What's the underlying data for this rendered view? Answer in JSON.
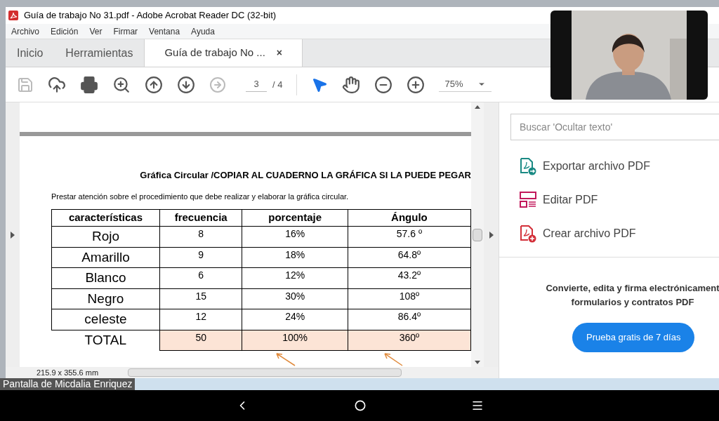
{
  "window": {
    "title": "Guía de trabajo No 31.pdf - Adobe Acrobat Reader DC (32-bit)"
  },
  "menu": [
    "Archivo",
    "Edición",
    "Ver",
    "Firmar",
    "Ventana",
    "Ayuda"
  ],
  "tabs": [
    {
      "label": "Inicio",
      "selected": false
    },
    {
      "label": "Herramientas",
      "selected": false
    },
    {
      "label": "Guía de trabajo No ...",
      "selected": true,
      "close": "×"
    }
  ],
  "toolbar": {
    "page": "3",
    "pages": "/ 4",
    "zoom": "75%"
  },
  "document": {
    "heading": "Gráfica Circular /COPIAR AL CUADERNO LA GRÁFICA SI LA PUEDE PEGAR",
    "instruction": "Prestar atención sobre el procedimiento que debe realizar y elaborar la gráfica circular.",
    "table": {
      "columns": [
        "características",
        "frecuencia",
        "porcentaje",
        "Ángulo"
      ],
      "rows": [
        {
          "kind": "data",
          "cells": [
            "Rojo",
            "8",
            "16%",
            "57.6 º"
          ]
        },
        {
          "kind": "data",
          "cells": [
            "Amarillo",
            "9",
            "18%",
            "64.8º"
          ]
        },
        {
          "kind": "data",
          "cells": [
            "Blanco",
            "6",
            "12%",
            "43.2º"
          ]
        },
        {
          "kind": "data",
          "cells": [
            "Negro",
            "15",
            "30%",
            "108º"
          ]
        },
        {
          "kind": "data",
          "cells": [
            "celeste",
            "12",
            "24%",
            "86.4º"
          ]
        },
        {
          "kind": "total",
          "cells": [
            "TOTAL",
            "50",
            "100%",
            "360º"
          ]
        }
      ]
    }
  },
  "page_size": "215.9 x 355.6 mm",
  "tools_pane": {
    "search": {
      "placeholder": "Buscar 'Ocultar texto'"
    },
    "tools": [
      {
        "kind": "export",
        "label": "Exportar archivo PDF"
      },
      {
        "kind": "edit",
        "label": "Editar PDF"
      },
      {
        "kind": "create",
        "label": "Crear archivo PDF"
      }
    ],
    "promo": "Convierte, edita y firma electrónicament formularios y contratos PDF",
    "button": "Prueba gratis de 7 días"
  },
  "screen_share": {
    "label": "Pantalla de Micdalia Enriquez"
  }
}
